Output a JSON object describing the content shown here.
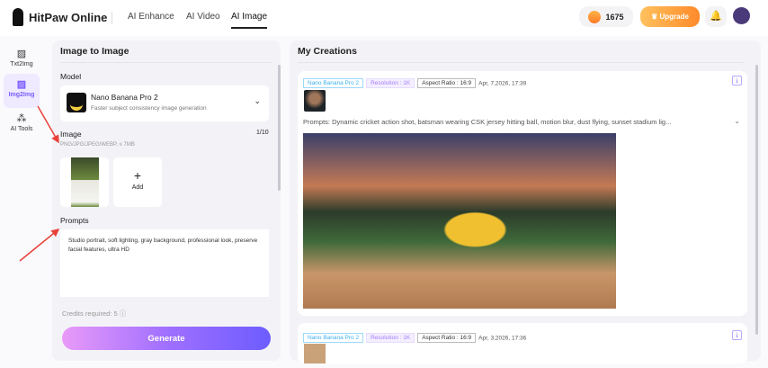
{
  "header": {
    "brand": "HitPaw Online",
    "nav": [
      "AI Enhance",
      "AI Video",
      "AI Image"
    ],
    "credits": "1675",
    "upgrade": "Upgrade"
  },
  "sidebar": [
    {
      "label": "Txt2Img"
    },
    {
      "label": "Img2Img"
    },
    {
      "label": "AI Tools"
    }
  ],
  "left": {
    "title": "Image to Image",
    "model_label": "Model",
    "model_name": "Nano Banana Pro 2",
    "model_desc": "Faster subject consistency image generation",
    "image_label": "Image",
    "image_count": "1/10",
    "formats": "PNG/JPG/JPEG/WEBP, ≤ 7MB",
    "add": "Add",
    "prompts_label": "Prompts",
    "prompt_text": "Studio portrait, soft lighting, gray background, professional look, preserve facial features, ultra HD",
    "credits": "Credits required: 5",
    "generate": "Generate"
  },
  "right": {
    "title": "My Creations",
    "items": [
      {
        "model": "Nano Banana Pro 2",
        "resolution": "Resolution : 1K",
        "aspect": "Aspect Ratio : 16:9",
        "date": "Apr, 7,2026, 17:39",
        "prompt": "Prompts: Dynamic cricket action shot, batsman wearing CSK jersey hitting ball, motion blur, dust flying, sunset stadium lig..."
      },
      {
        "model": "Nano Banana Pro 2",
        "resolution": "Resolution : 1K",
        "aspect": "Aspect Ratio : 16:9",
        "date": "Apr, 3,2026, 17:36"
      }
    ]
  }
}
